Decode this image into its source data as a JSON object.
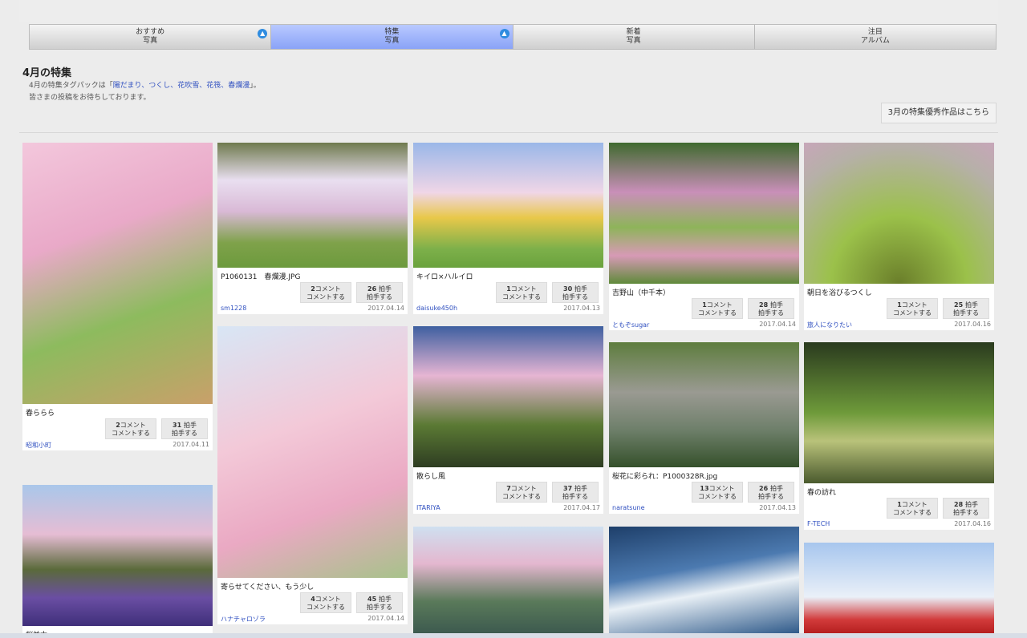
{
  "tabs": [
    {
      "line1": "おすすめ",
      "line2": "写真",
      "badge": "▲",
      "active": false
    },
    {
      "line1": "特集",
      "line2": "写真",
      "badge": "▲",
      "active": true
    },
    {
      "line1": "新着",
      "line2": "写真",
      "badge": "",
      "active": false
    },
    {
      "line1": "注目",
      "line2": "アルバム",
      "badge": "",
      "active": false
    }
  ],
  "section": {
    "title": "4月の特集",
    "desc1_prefix": "4月の特集タグパックは「",
    "desc1_tags": "陽だまり、つくし、花吹雪、花筏、春爛漫",
    "desc1_suffix": "」。",
    "desc2": "皆さまの投稿をお待ちしております。",
    "prev_button": "3月の特集優秀作品はこちら"
  },
  "cards": [
    {
      "caption": "春ららら",
      "comments": "2",
      "likes": "31",
      "user": "昭和小町",
      "date": "2017.04.11"
    },
    {
      "caption": "P1060131　春爛漫.JPG",
      "comments": "2",
      "likes": "26",
      "user": "sm1228",
      "date": "2017.04.14"
    },
    {
      "caption": "キイロ×ハルイロ",
      "comments": "1",
      "likes": "30",
      "user": "daisuke450h",
      "date": "2017.04.13"
    },
    {
      "caption": "吉野山（中千本）",
      "comments": "1",
      "likes": "28",
      "user": "ともぞsugar",
      "date": "2017.04.14"
    },
    {
      "caption": "朝日を浴びるつくし",
      "comments": "1",
      "likes": "25",
      "user": "旅人になりたい",
      "date": "2017.04.16"
    },
    {
      "caption": "寄らせてください、もう少し",
      "comments": "4",
      "likes": "45",
      "user": "ハナチャロゾラ",
      "date": "2017.04.14"
    },
    {
      "caption": "散らし風",
      "comments": "7",
      "likes": "37",
      "user": "ITARIYA",
      "date": "2017.04.17"
    },
    {
      "caption": "桜花に彩られ：P1000328R.jpg",
      "comments": "13",
      "likes": "26",
      "user": "naratsune",
      "date": "2017.04.13"
    },
    {
      "caption": "春の訪れ",
      "comments": "1",
      "likes": "28",
      "user": "F-TECH",
      "date": "2017.04.16"
    },
    {
      "caption": "桜並木",
      "comments": "",
      "likes": "",
      "user": "",
      "date": ""
    }
  ],
  "labels": {
    "comment_unit": "コメント",
    "comment_action": "コメントする",
    "like_unit": "拍手",
    "like_action": "拍手する"
  },
  "colors": {
    "active_tab": "#8aa3f7",
    "link": "#3050c0"
  }
}
